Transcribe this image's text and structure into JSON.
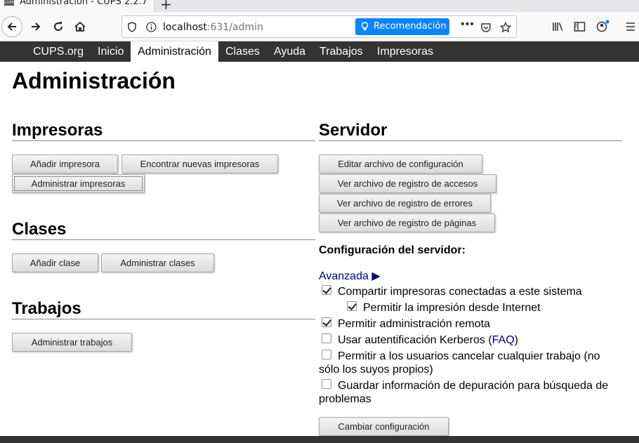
{
  "browser": {
    "tab_title": "Administración - CUPS 2.2.7",
    "favicon_text": "CUPS",
    "url_host": "localhost",
    "url_rest": ":631/admin",
    "recommendation": "Recomendación"
  },
  "cups_nav": [
    "CUPS.org",
    "Inicio",
    "Administración",
    "Clases",
    "Ayuda",
    "Trabajos",
    "Impresoras"
  ],
  "page_title": "Administración",
  "printers": {
    "title": "Impresoras",
    "add": "Añadir impresora",
    "find": "Encontrar nuevas impresoras",
    "manage": "Administrar impresoras"
  },
  "classes": {
    "title": "Clases",
    "add": "Añadir clase",
    "manage": "Administrar clases"
  },
  "jobs": {
    "title": "Trabajos",
    "manage": "Administrar trabajos"
  },
  "server": {
    "title": "Servidor",
    "edit_config": "Editar archivo de configuración",
    "access_log": "Ver archivo de registro de accesos",
    "error_log": "Ver archivo de registro de errores",
    "page_log": "Ver archivo de registro de páginas",
    "settings_heading": "Configuración del servidor:",
    "advanced": "Avanzada ▶",
    "share_printers": "Compartir impresoras conectadas a este sistema",
    "allow_internet": "Permitir la impresión desde Internet",
    "remote_admin": "Permitir administración remota",
    "kerberos_prefix": "Usar autentificación Kerberos (",
    "kerberos_faq": "FAQ",
    "kerberos_suffix": ")",
    "user_cancel": "Permitir a los usuarios cancelar cualquier trabajo (no sólo los suyos propios)",
    "debug_info": "Guardar información de depuración para búsqueda de problemas",
    "change_settings": "Cambiar configuración"
  },
  "checkbox_states": {
    "share_printers": true,
    "allow_internet": true,
    "remote_admin": true,
    "kerberos": false,
    "user_cancel": false,
    "debug_info": false
  }
}
